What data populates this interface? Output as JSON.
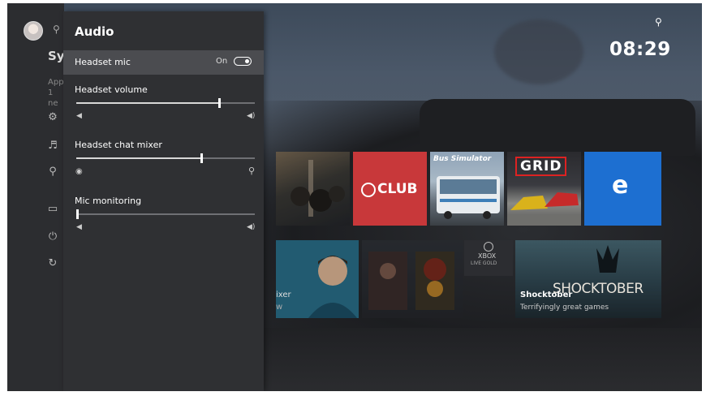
{
  "clock": {
    "mic_icon": "mic-status-icon",
    "time": "08:29"
  },
  "sidebar": {
    "title_partial": "Sy",
    "apps_partial_1": "App",
    "apps_partial_2": "1 ne",
    "icons": [
      "settings-icon",
      "volume-icon",
      "lightbulb-icon",
      "tv-icon",
      "power-icon",
      "restart-icon"
    ]
  },
  "tiles": {
    "club_label": "CLUB",
    "bus_label": "Bus Simulator",
    "grid_label": "GRID",
    "edge_label": "e",
    "gold_line1": "XBOX",
    "gold_line2": "LIVE GOLD",
    "shock_logo": "SHOCKTOBER",
    "shock_title": "Shocktober",
    "shock_subtitle": "Terrifyingly great games",
    "mixer_partial_1": "ixer",
    "mixer_partial_2": "w"
  },
  "audio_panel": {
    "title": "Audio",
    "headset_mic": {
      "label": "Headset mic",
      "state": "On",
      "enabled": true
    },
    "headset_volume": {
      "label": "Headset volume",
      "value": 0.8
    },
    "chat_mixer": {
      "label": "Headset chat mixer",
      "value": 0.7
    },
    "mic_monitoring": {
      "label": "Mic monitoring",
      "value": 0.0
    }
  }
}
